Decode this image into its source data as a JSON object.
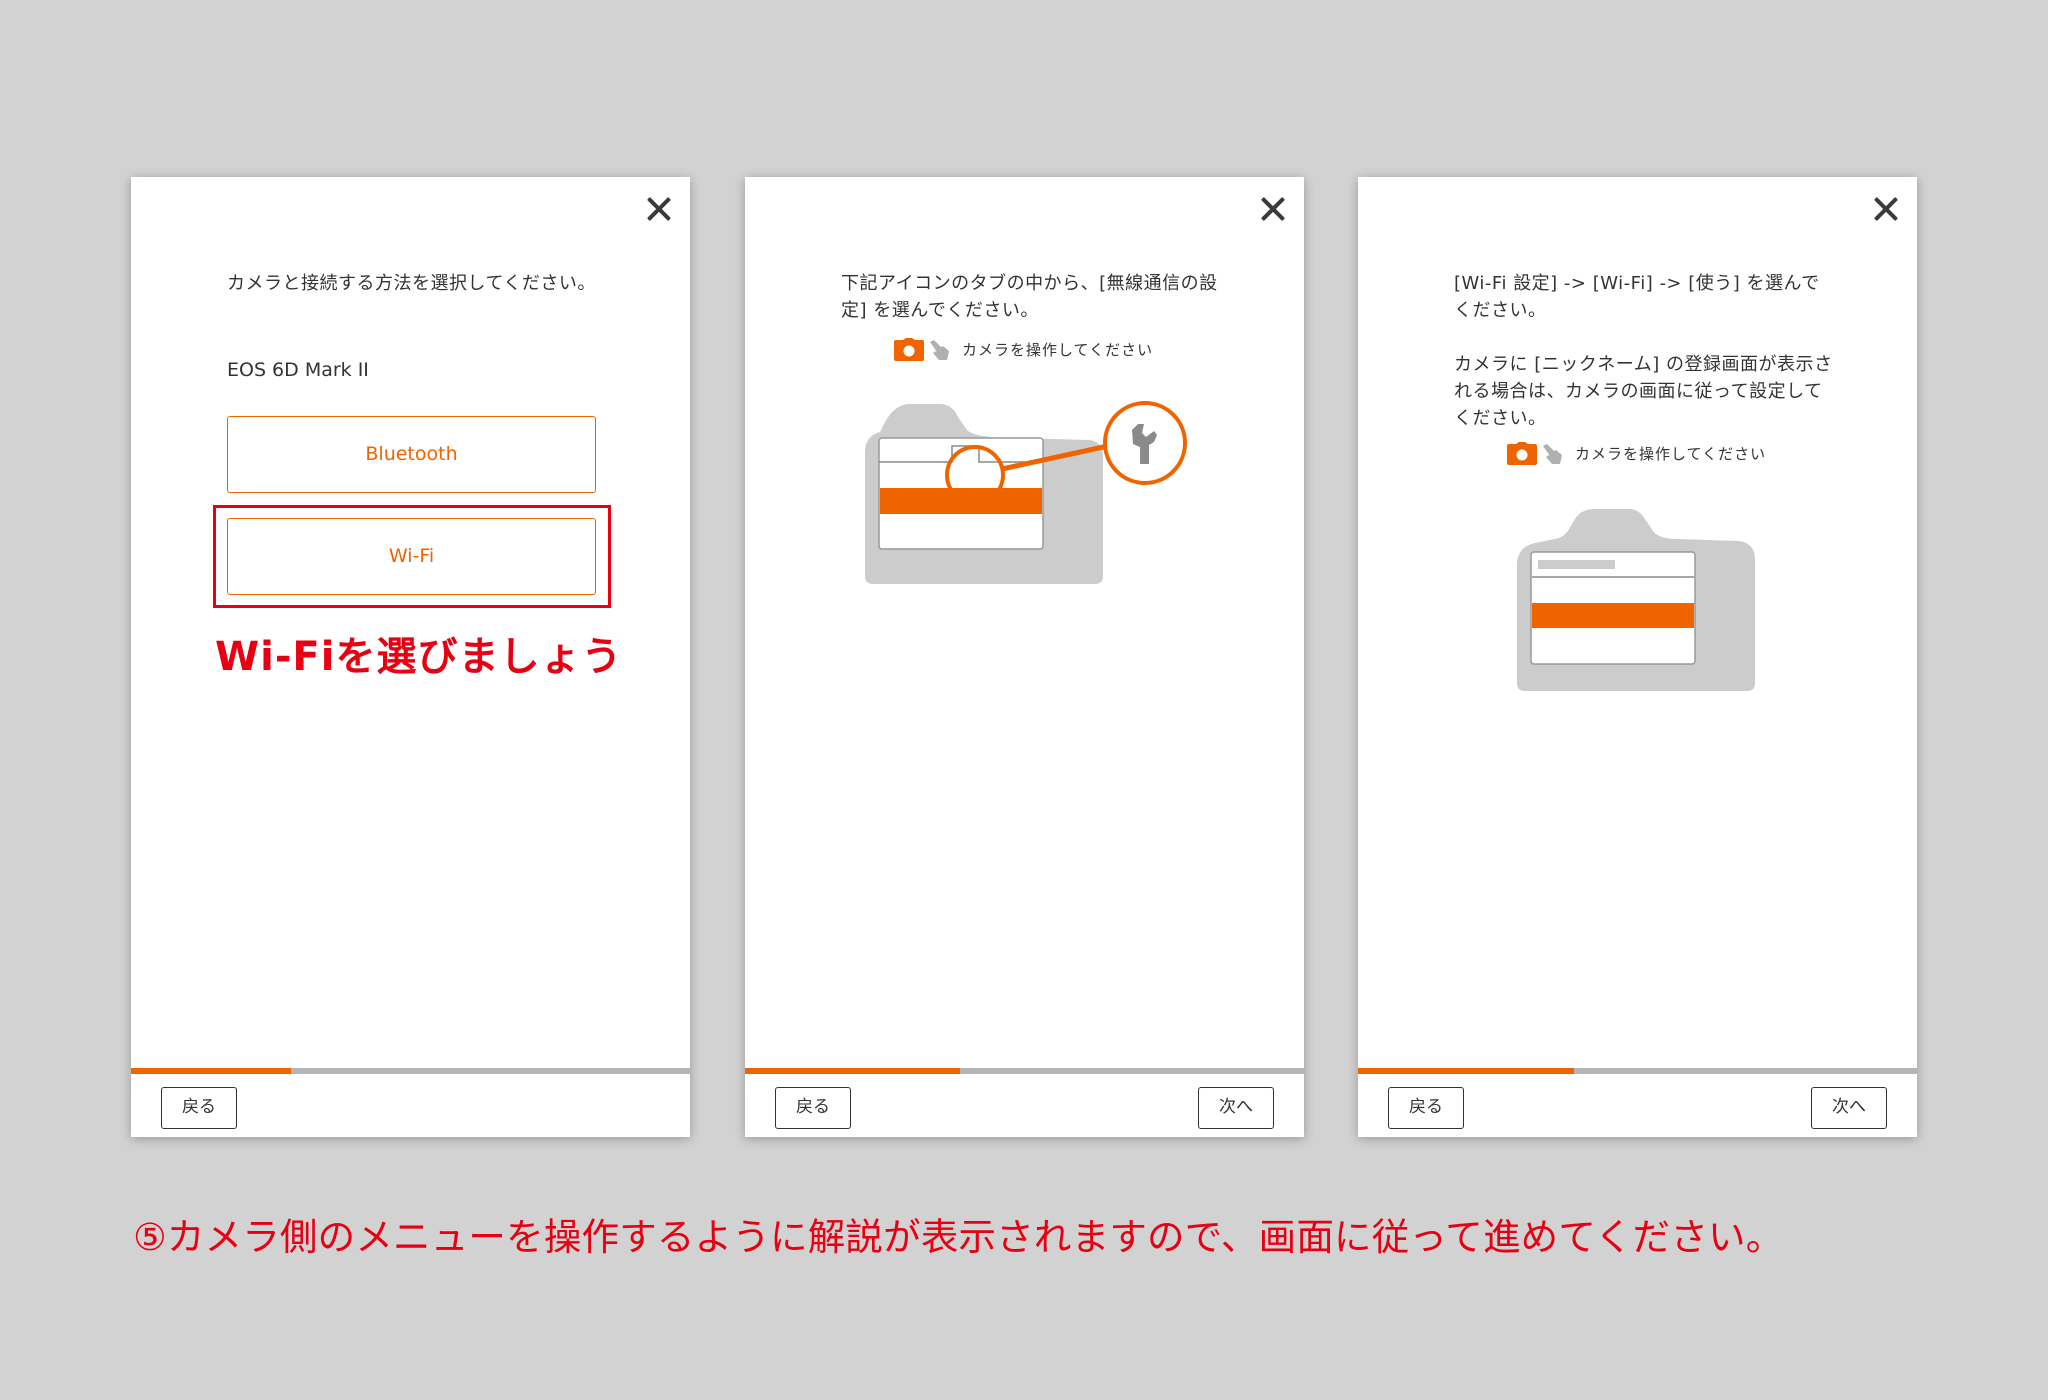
{
  "colors": {
    "accent": "#f06400",
    "annotation_red": "#e60012",
    "background": "#d2d2d2",
    "progress_track": "#b5b5b5",
    "illustration_gray": "#cccccc",
    "icon_gray": "#8a8a8a"
  },
  "panels": [
    {
      "close_icon": "close-icon",
      "description": [
        "カメラと接続する方法を選択してください。"
      ],
      "model_name": "EOS 6D Mark II",
      "options": [
        {
          "label": "Bluetooth"
        },
        {
          "label": "Wi-Fi",
          "highlighted": true
        }
      ],
      "callout": "Wi-Fiを選びましょう",
      "progress_fraction": 0.286,
      "back_label": "戻る"
    },
    {
      "close_icon": "close-icon",
      "description": [
        "下記アイコンのタブの中から、[無線通信の設定] を選んでください。"
      ],
      "hint": {
        "icons": [
          "camera-icon",
          "hand-pointer-icon"
        ],
        "text": "カメラを操作してください"
      },
      "illustration": {
        "type": "camera-back-with-tab-zoom",
        "zoom_icon": "wrench-icon"
      },
      "progress_fraction": 0.385,
      "back_label": "戻る",
      "next_label": "次へ"
    },
    {
      "close_icon": "close-icon",
      "description": [
        "[Wi-Fi 設定] -> [Wi-Fi] -> [使う] を選んでください。",
        "カメラに [ニックネーム] の登録画面が表示される場合は、カメラの画面に従って設定してください。"
      ],
      "hint": {
        "icons": [
          "camera-icon",
          "hand-pointer-icon"
        ],
        "text": "カメラを操作してください"
      },
      "illustration": {
        "type": "camera-back-menu"
      },
      "progress_fraction": 0.386,
      "back_label": "戻る",
      "next_label": "次へ"
    }
  ],
  "caption": "⑤カメラ側のメニューを操作するように解説が表示されますので、画面に従って進めてください。"
}
